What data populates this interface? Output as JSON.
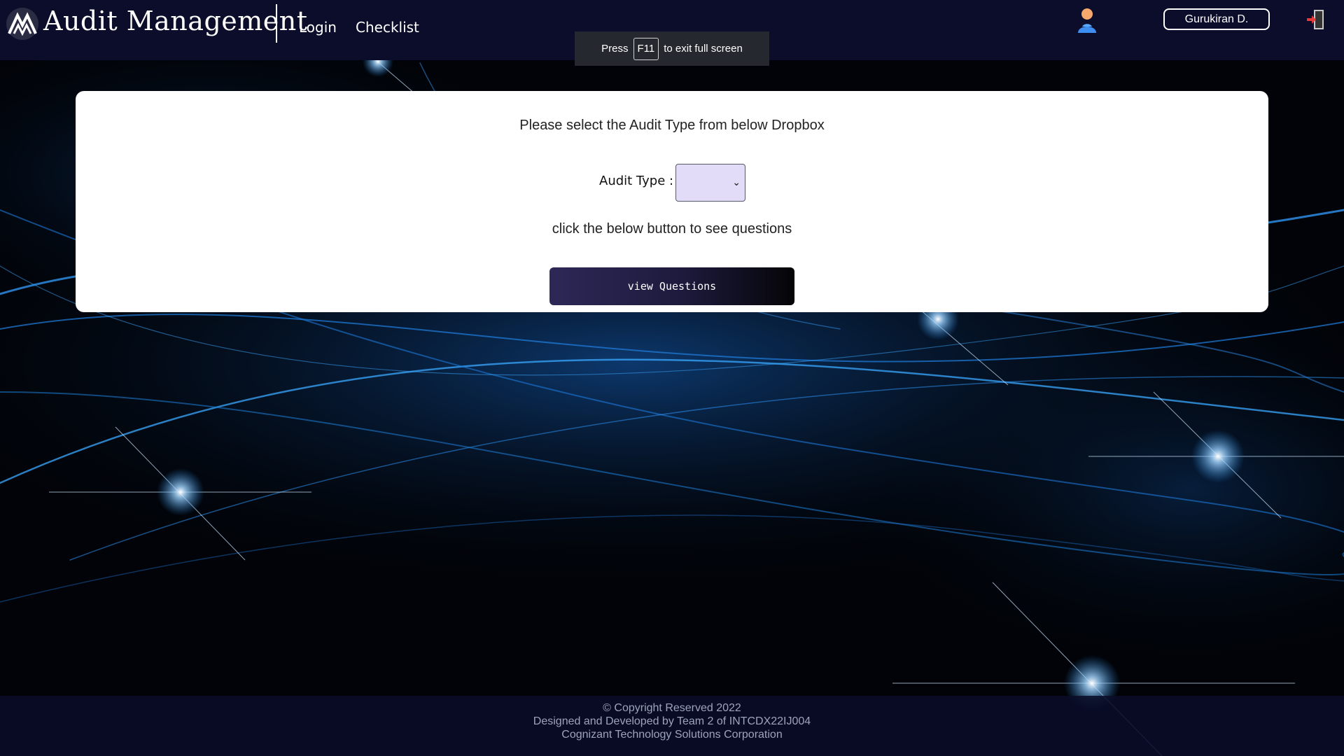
{
  "header": {
    "brand": "Audit Management",
    "nav": [
      {
        "label": "Login"
      },
      {
        "label": "Checklist"
      }
    ],
    "user_name": "Gurukiran D."
  },
  "toast": {
    "press": "Press",
    "key": "F11",
    "suffix": "to exit full screen"
  },
  "card": {
    "title": "Please select the Audit Type from below Dropbox",
    "audit_type_label": "Audit Type :",
    "audit_type_value": "",
    "hint": "click the below button to see questions",
    "button_label": "view Questions"
  },
  "footer": {
    "line1": "© Copyright Reserved 2022",
    "line2": "Designed and Developed by Team 2 of INTCDX22IJ004",
    "line3": "Cognizant Technology Solutions Corporation"
  },
  "colors": {
    "header_bg": "#0c0d2a",
    "select_bg": "#e3dcf8",
    "button_gradient_start": "#2d2857",
    "button_gradient_end": "#050507",
    "background_accent": "#1e7fd8"
  }
}
